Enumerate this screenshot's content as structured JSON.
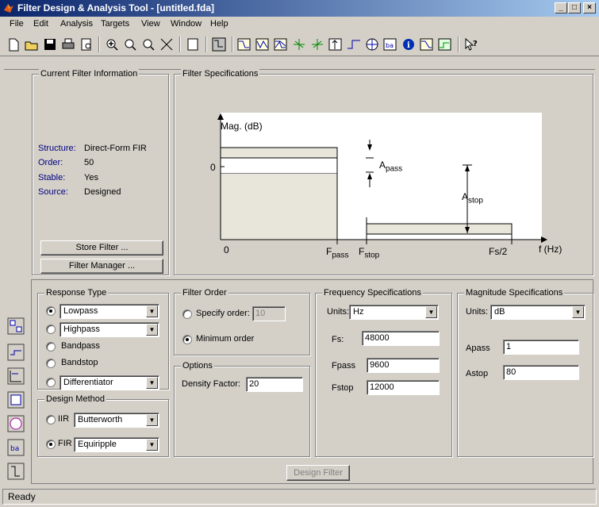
{
  "window": {
    "title": "Filter Design & Analysis Tool - [untitled.fda]"
  },
  "menu": [
    "File",
    "Edit",
    "Analysis",
    "Targets",
    "View",
    "Window",
    "Help"
  ],
  "current_filter": {
    "title": "Current Filter Information",
    "structure_label": "Structure:",
    "structure": "Direct-Form FIR",
    "order_label": "Order:",
    "order": "50",
    "stable_label": "Stable:",
    "stable": "Yes",
    "source_label": "Source:",
    "source": "Designed",
    "store_button": "Store Filter ...",
    "manager_button": "Filter Manager ..."
  },
  "spec_plot": {
    "title": "Filter Specifications",
    "mag_label": "Mag. (dB)",
    "zero_y": "0",
    "zero_x": "0",
    "apass_main": "A",
    "apass_sub": "pass",
    "astop_main": "A",
    "astop_sub": "stop",
    "fpass_main": "F",
    "fpass_sub": "pass",
    "fstop_main": "F",
    "fstop_sub": "stop",
    "fs2": "Fs/2",
    "fhz": "f (Hz)"
  },
  "response_type": {
    "title": "Response Type",
    "lowpass": "Lowpass",
    "highpass": "Highpass",
    "bandpass": "Bandpass",
    "bandstop": "Bandstop",
    "differentiator": "Differentiator"
  },
  "design_method": {
    "title": "Design Method",
    "iir_label": "IIR",
    "iir_value": "Butterworth",
    "fir_label": "FIR",
    "fir_value": "Equiripple"
  },
  "filter_order": {
    "title": "Filter Order",
    "specify_label": "Specify order:",
    "specify_value": "10",
    "minimum_label": "Minimum order"
  },
  "options": {
    "title": "Options",
    "density_label": "Density Factor:",
    "density_value": "20"
  },
  "freq_specs": {
    "title": "Frequency Specifications",
    "units_label": "Units:",
    "units_value": "Hz",
    "fs_label": "Fs:",
    "fs_value": "48000",
    "fpass_label": "Fpass",
    "fpass_value": "9600",
    "fstop_label": "Fstop",
    "fstop_value": "12000"
  },
  "mag_specs": {
    "title": "Magnitude Specifications",
    "units_label": "Units:",
    "units_value": "dB",
    "apass_label": "Apass",
    "apass_value": "1",
    "astop_label": "Astop",
    "astop_value": "80"
  },
  "design_button": "Design Filter",
  "status": "Ready"
}
